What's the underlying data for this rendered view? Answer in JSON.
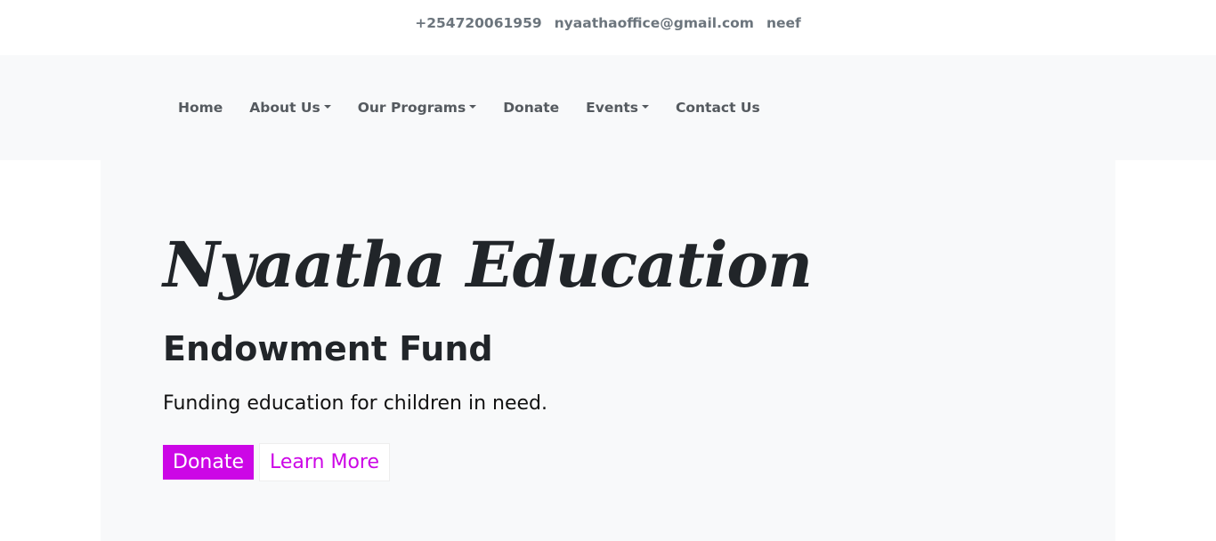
{
  "topbar": {
    "phone": "+254720061959",
    "email": "nyaathaoffice@gmail.com",
    "brand": "neef"
  },
  "nav": {
    "items": [
      {
        "label": "Home",
        "dropdown": false
      },
      {
        "label": "About Us",
        "dropdown": true
      },
      {
        "label": "Our Programs",
        "dropdown": true
      },
      {
        "label": "Donate",
        "dropdown": false
      },
      {
        "label": "Events",
        "dropdown": true
      },
      {
        "label": "Contact Us",
        "dropdown": false
      }
    ]
  },
  "hero": {
    "title": "Nyaatha Education",
    "subtitle": "Endowment Fund",
    "lead": "Funding education for children in need.",
    "donate_label": "Donate",
    "learn_more_label": "Learn More"
  },
  "colors": {
    "accent": "#cc07e6",
    "nav_bg": "#f8f9fa",
    "muted_text": "#6c757d"
  }
}
